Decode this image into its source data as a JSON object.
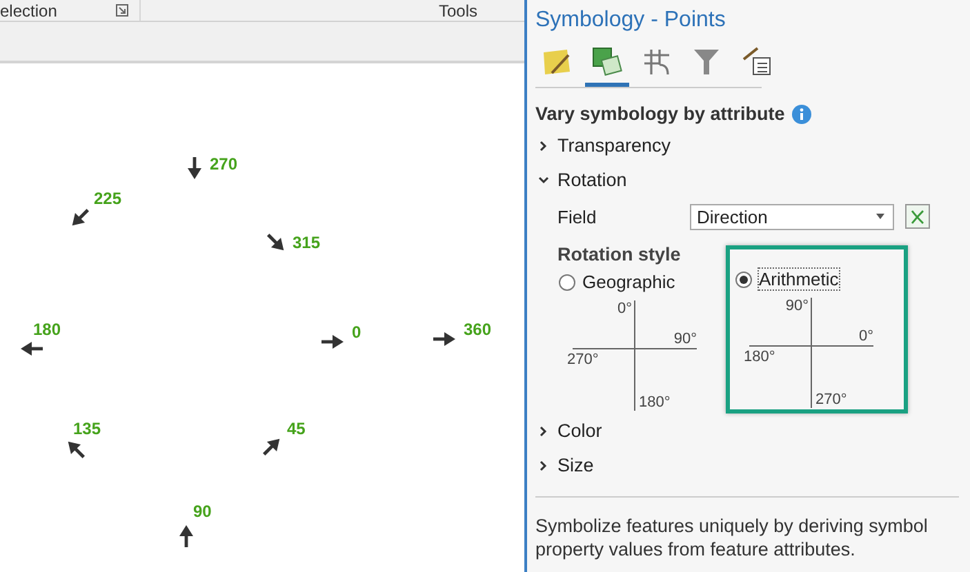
{
  "ribbon": {
    "groups": [
      {
        "label": "election",
        "launcher": true
      },
      {
        "label": "Tools",
        "launcher": false
      }
    ]
  },
  "map": {
    "points": [
      {
        "label": "270",
        "kind": "south"
      },
      {
        "label": "225",
        "kind": "southwest"
      },
      {
        "label": "315",
        "kind": "southeast"
      },
      {
        "label": "180",
        "kind": "west"
      },
      {
        "label": "0",
        "kind": "east"
      },
      {
        "label": "360",
        "kind": "east"
      },
      {
        "label": "135",
        "kind": "northwest"
      },
      {
        "label": "45",
        "kind": "northeast"
      },
      {
        "label": "90",
        "kind": "north"
      }
    ]
  },
  "panel": {
    "title": "Symbology - Points",
    "tabs": [
      {
        "selected": false
      },
      {
        "selected": true
      },
      {
        "selected": false
      },
      {
        "selected": false
      },
      {
        "selected": false
      }
    ],
    "heading": "Vary symbology by attribute",
    "sections": [
      {
        "label": "Transparency",
        "expanded": false
      },
      {
        "label": "Rotation",
        "expanded": true,
        "field": {
          "label": "Field",
          "value": "Direction"
        },
        "style": {
          "label": "Rotation style",
          "options": [
            {
              "label": "Geographic",
              "selected": false,
              "compass": {
                "north": "0°",
                "east": "90°",
                "south": "180°",
                "west": "270°"
              }
            },
            {
              "label": "Arithmetic",
              "selected": true,
              "compass": {
                "north": "90°",
                "east": "0°",
                "south": "270°",
                "west": "180°"
              }
            }
          ]
        }
      },
      {
        "label": "Color",
        "expanded": false
      },
      {
        "label": "Size",
        "expanded": false
      }
    ],
    "description": "Symbolize features uniquely by deriving symbol property values from feature attributes."
  }
}
